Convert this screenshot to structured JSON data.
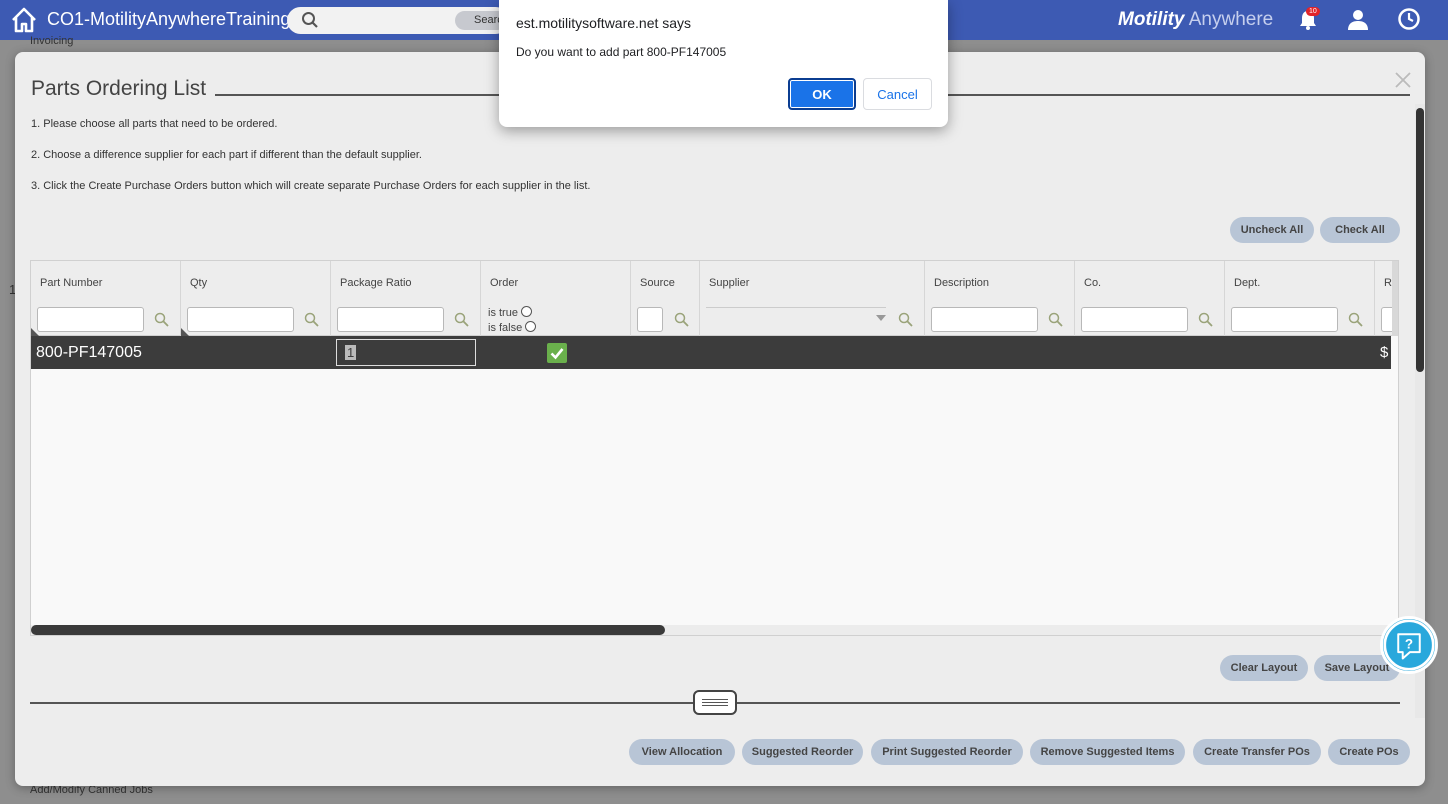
{
  "topbar": {
    "app_title": "CO1-MotilityAnywhereTraining",
    "search_button_label": "Search",
    "brand_bold": "Motility",
    "brand_light": " Anywhere",
    "notification_count": "10"
  },
  "background": {
    "top_text": "Invoicing",
    "bottom_text": "Add/Modify Canned Jobs",
    "side_text": "1"
  },
  "modal": {
    "title": "Parts Ordering List",
    "instructions": [
      "1. Please choose all parts that need to be ordered.",
      "2. Choose a difference supplier for each part if different than the default supplier.",
      "3. Click the Create Purchase Orders button which will create separate Purchase Orders for each supplier in the list."
    ],
    "uncheck_all": "Uncheck All",
    "check_all": "Check All",
    "clear_layout": "Clear Layout",
    "save_layout": "Save Layout",
    "footer_buttons": [
      "View Allocation",
      "Suggested Reorder",
      "Print Suggested Reorder",
      "Remove Suggested Items",
      "Create Transfer POs",
      "Create POs"
    ]
  },
  "grid": {
    "columns": [
      "Part Number",
      "Qty",
      "Package Ratio",
      "Order",
      "Source",
      "Supplier",
      "Description",
      "Co.",
      "Dept.",
      "R"
    ],
    "order_filter": {
      "is_true": "is true",
      "is_false": "is false"
    },
    "rows": [
      {
        "part_number": "800-PF147005",
        "package_ratio_edit": "1",
        "order_checked": true,
        "price_prefix": "$"
      }
    ]
  },
  "dialog": {
    "origin": "est.motilitysoftware.net says",
    "message": "Do you want to add part 800-PF147005",
    "ok": "OK",
    "cancel": "Cancel"
  },
  "colors": {
    "topbar": "#3d5ab3",
    "dialog_ok": "#1a73e8",
    "row_selected": "#3c3c3c",
    "checkbox": "#6ab04c",
    "help": "#29a8dc"
  }
}
